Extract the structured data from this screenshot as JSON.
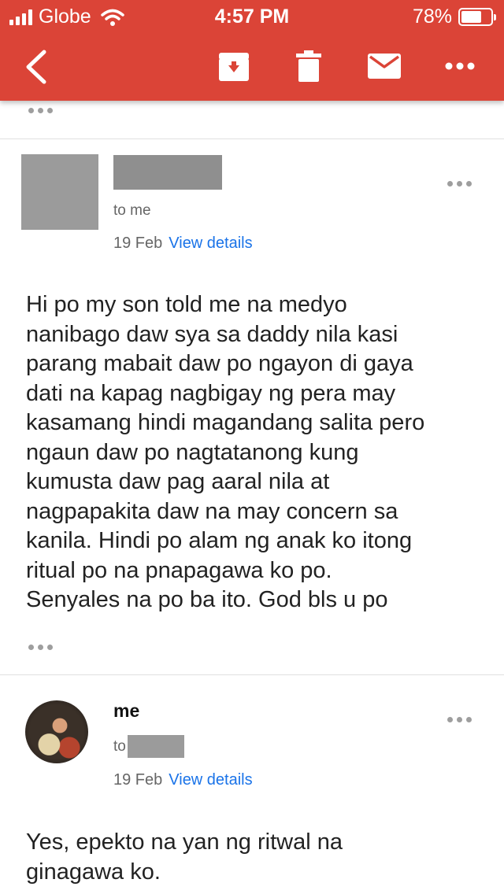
{
  "status_bar": {
    "carrier": "Globe",
    "time": "4:57 PM",
    "battery_percent": "78%",
    "battery_level": 0.78
  },
  "toolbar": {
    "icons": [
      "back-arrow-icon",
      "archive-icon",
      "trash-icon",
      "mail-icon",
      "more-icon"
    ],
    "background_color": "#db4437"
  },
  "messages": [
    {
      "sender": "",
      "to_line": "to me",
      "date": "19 Feb",
      "details_link": "View details",
      "body_lines": [
        "Hi po my son told me na medyo",
        "nanibago daw sya sa daddy nila kasi",
        "parang mabait daw po ngayon di gaya",
        "dati na kapag nagbigay ng pera may",
        "kasamang hindi magandang salita pero",
        "ngaun daw po nagtatanong kung",
        "kumusta daw pag aaral nila at",
        "nagpapakita daw na may concern sa",
        "kanila. Hindi po alam ng anak ko itong",
        "ritual po na pnapagawa ko po.",
        "Senyales na po ba ito. God bls u po"
      ]
    },
    {
      "sender": "me",
      "to_prefix": "to",
      "date": "19 Feb",
      "details_link": "View details",
      "body_lines": [
        "Yes, epekto na yan ng ritwal na",
        "ginagawa ko."
      ]
    }
  ],
  "colors": {
    "link": "#1a73e8",
    "redaction": "#9b9b9b"
  }
}
